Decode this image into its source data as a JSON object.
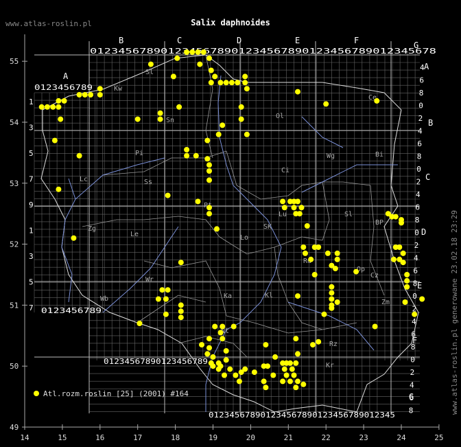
{
  "title": "Salix daphnoides",
  "site": "www.atlas-roslin.pl",
  "generated": "www.atlas-roslin.pl generowane 23.02.18 23:29",
  "legend": {
    "label": "Atl.rozm.roslin [25] (2001) #164",
    "color": "#ffff00"
  },
  "x_ticks": [
    "14",
    "15",
    "16",
    "17",
    "18",
    "19",
    "20",
    "21",
    "22",
    "23",
    "24",
    "25"
  ],
  "y_ticks": [
    "49",
    "50",
    "51",
    "52",
    "53",
    "54",
    "55"
  ],
  "square_letters_top": [
    "A",
    "B",
    "C",
    "D",
    "E",
    "F",
    "G"
  ],
  "square_letters_right": [
    "A",
    "B",
    "C",
    "D",
    "E",
    "F",
    "G"
  ],
  "col_digits_top": "0123456789012345678901234567890123456789012345678",
  "col_digits_bottom": "012345678901234567890123456789012345",
  "col_digits_a": "0123456789",
  "col_digits_sw": "0123456789",
  "region_labels": [
    "Sl",
    "Sn",
    "Kw",
    "Pi",
    "Ol",
    "Ci",
    "Wg",
    "Bi",
    "Sl",
    "BP",
    "Pt",
    "Lo",
    "SK",
    "Le",
    "Zg",
    "Lc",
    "Rd",
    "Lu",
    "Wr",
    "Op",
    "Kl",
    "Cz",
    "Ka",
    "Zm",
    "Wb",
    "Ss",
    "Nt",
    "Kr",
    "Rz",
    "Ce"
  ],
  "points": [
    [
      14.45,
      54.25
    ],
    [
      14.6,
      54.25
    ],
    [
      14.75,
      54.25
    ],
    [
      14.9,
      54.25
    ],
    [
      14.9,
      54.35
    ],
    [
      15.05,
      54.35
    ],
    [
      15.45,
      54.45
    ],
    [
      15.6,
      54.45
    ],
    [
      15.75,
      54.45
    ],
    [
      16.0,
      54.45
    ],
    [
      16.0,
      54.55
    ],
    [
      14.95,
      54.05
    ],
    [
      14.8,
      53.7
    ],
    [
      15.45,
      53.45
    ],
    [
      14.9,
      52.9
    ],
    [
      15.3,
      52.1
    ],
    [
      17.35,
      54.95
    ],
    [
      17.95,
      54.75
    ],
    [
      18.05,
      55.05
    ],
    [
      18.3,
      55.15
    ],
    [
      18.45,
      55.15
    ],
    [
      18.6,
      55.15
    ],
    [
      18.75,
      55.15
    ],
    [
      18.9,
      55.05
    ],
    [
      18.65,
      54.95
    ],
    [
      18.95,
      54.85
    ],
    [
      19.05,
      54.75
    ],
    [
      19.2,
      54.65
    ],
    [
      19.35,
      54.65
    ],
    [
      19.5,
      54.65
    ],
    [
      19.65,
      54.65
    ],
    [
      19.85,
      54.65
    ],
    [
      19.85,
      54.75
    ],
    [
      19.9,
      54.55
    ],
    [
      18.95,
      54.65
    ],
    [
      19.75,
      54.25
    ],
    [
      19.75,
      54.05
    ],
    [
      19.25,
      53.95
    ],
    [
      18.1,
      54.25
    ],
    [
      17.6,
      54.15
    ],
    [
      17.6,
      54.05
    ],
    [
      17.0,
      54.05
    ],
    [
      18.3,
      53.55
    ],
    [
      18.3,
      53.45
    ],
    [
      18.55,
      53.45
    ],
    [
      18.85,
      53.7
    ],
    [
      18.85,
      53.4
    ],
    [
      18.9,
      53.3
    ],
    [
      18.9,
      53.2
    ],
    [
      18.9,
      53.05
    ],
    [
      19.15,
      53.8
    ],
    [
      19.9,
      53.8
    ],
    [
      18.6,
      52.7
    ],
    [
      17.8,
      52.8
    ],
    [
      18.9,
      52.6
    ],
    [
      18.9,
      52.5
    ],
    [
      19.1,
      52.25
    ],
    [
      18.15,
      51.7
    ],
    [
      21.25,
      54.5
    ],
    [
      22.0,
      54.3
    ],
    [
      23.35,
      54.35
    ],
    [
      20.85,
      52.7
    ],
    [
      21.05,
      52.7
    ],
    [
      21.15,
      52.7
    ],
    [
      21.25,
      52.7
    ],
    [
      20.9,
      52.6
    ],
    [
      21.15,
      52.6
    ],
    [
      21.35,
      52.6
    ],
    [
      21.3,
      52.5
    ],
    [
      21.2,
      52.5
    ],
    [
      21.5,
      52.3
    ],
    [
      21.4,
      51.95
    ],
    [
      21.45,
      51.85
    ],
    [
      21.7,
      51.95
    ],
    [
      21.8,
      51.95
    ],
    [
      22.05,
      51.85
    ],
    [
      22.3,
      51.85
    ],
    [
      22.3,
      51.75
    ],
    [
      22.15,
      51.65
    ],
    [
      22.25,
      51.6
    ],
    [
      21.6,
      51.75
    ],
    [
      21.7,
      51.5
    ],
    [
      22.15,
      51.3
    ],
    [
      22.15,
      51.2
    ],
    [
      22.15,
      51.1
    ],
    [
      22.15,
      51.0
    ],
    [
      22.3,
      51.05
    ],
    [
      21.95,
      50.85
    ],
    [
      22.15,
      50.95
    ],
    [
      21.25,
      51.15
    ],
    [
      22.8,
      51.55
    ],
    [
      23.65,
      52.5
    ],
    [
      23.75,
      52.45
    ],
    [
      23.85,
      52.45
    ],
    [
      24.0,
      52.4
    ],
    [
      24.0,
      52.35
    ],
    [
      23.85,
      51.95
    ],
    [
      23.95,
      51.95
    ],
    [
      24.05,
      51.85
    ],
    [
      23.8,
      51.75
    ],
    [
      23.95,
      51.75
    ],
    [
      24.05,
      51.7
    ],
    [
      24.15,
      51.5
    ],
    [
      24.15,
      51.4
    ],
    [
      24.15,
      51.3
    ],
    [
      24.1,
      51.05
    ],
    [
      24.35,
      50.85
    ],
    [
      24.55,
      51.1
    ],
    [
      23.3,
      50.65
    ],
    [
      17.65,
      51.25
    ],
    [
      17.8,
      51.25
    ],
    [
      17.55,
      51.1
    ],
    [
      17.75,
      51.1
    ],
    [
      17.75,
      50.85
    ],
    [
      17.05,
      50.7
    ],
    [
      18.15,
      51.0
    ],
    [
      18.15,
      50.9
    ],
    [
      18.15,
      50.8
    ],
    [
      19.05,
      50.65
    ],
    [
      19.25,
      50.65
    ],
    [
      19.55,
      50.65
    ],
    [
      19.2,
      50.55
    ],
    [
      19.25,
      50.45
    ],
    [
      18.9,
      50.45
    ],
    [
      18.7,
      50.35
    ],
    [
      18.9,
      50.3
    ],
    [
      18.85,
      50.2
    ],
    [
      19.0,
      50.15
    ],
    [
      18.95,
      50.05
    ],
    [
      19.15,
      50.05
    ],
    [
      19.35,
      50.1
    ],
    [
      19.35,
      50.25
    ],
    [
      19.0,
      50.0
    ],
    [
      19.15,
      49.95
    ],
    [
      19.45,
      49.95
    ],
    [
      19.6,
      49.85
    ],
    [
      19.75,
      49.9
    ],
    [
      19.85,
      49.95
    ],
    [
      19.7,
      49.75
    ],
    [
      20.35,
      50.0
    ],
    [
      20.45,
      50.0
    ],
    [
      20.1,
      49.9
    ],
    [
      20.35,
      49.75
    ],
    [
      20.4,
      49.65
    ],
    [
      20.6,
      49.85
    ],
    [
      20.65,
      50.15
    ],
    [
      20.85,
      50.05
    ],
    [
      20.95,
      50.05
    ],
    [
      21.05,
      50.05
    ],
    [
      20.9,
      49.95
    ],
    [
      21.1,
      49.95
    ],
    [
      20.95,
      49.85
    ],
    [
      21.05,
      49.75
    ],
    [
      21.25,
      49.75
    ],
    [
      21.15,
      49.85
    ],
    [
      21.2,
      50.05
    ],
    [
      21.25,
      50.2
    ],
    [
      21.4,
      49.7
    ],
    [
      21.2,
      49.65
    ],
    [
      20.85,
      49.75
    ],
    [
      20.4,
      50.35
    ],
    [
      21.65,
      50.35
    ],
    [
      21.8,
      50.4
    ],
    [
      21.2,
      50.45
    ],
    [
      19.3,
      49.85
    ],
    [
      19.2,
      50.0
    ]
  ]
}
